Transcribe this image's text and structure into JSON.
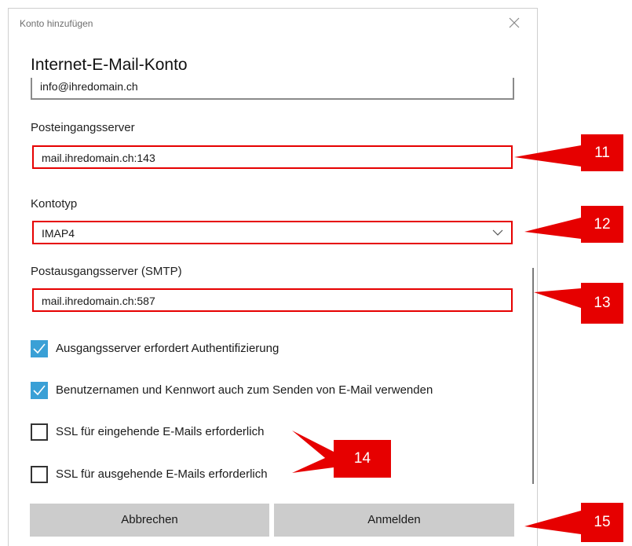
{
  "dialog": {
    "title": "Konto hinzufügen",
    "heading": "Internet-E-Mail-Konto",
    "email_value": "info@ihredomain.ch"
  },
  "incoming": {
    "label": "Posteingangsserver",
    "value": "mail.ihredomain.ch:143"
  },
  "account_type": {
    "label": "Kontotyp",
    "value": "IMAP4"
  },
  "outgoing": {
    "label": "Postausgangsserver (SMTP)",
    "value": "mail.ihredomain.ch:587"
  },
  "checkboxes": [
    {
      "label": "Ausgangsserver erfordert Authentifizierung",
      "checked": true
    },
    {
      "label": "Benutzernamen und Kennwort auch zum Senden von E-Mail verwenden",
      "checked": true
    },
    {
      "label": "SSL für eingehende E-Mails erforderlich",
      "checked": false
    },
    {
      "label": "SSL für ausgehende E-Mails erforderlich",
      "checked": false
    }
  ],
  "buttons": {
    "cancel": "Abbrechen",
    "signin": "Anmelden"
  },
  "annotations": {
    "n11": "11",
    "n12": "12",
    "n13": "13",
    "n14": "14",
    "n15": "15"
  },
  "colors": {
    "highlight": "#e60000",
    "checkbox": "#3aa0d6",
    "button": "#cccccc"
  }
}
